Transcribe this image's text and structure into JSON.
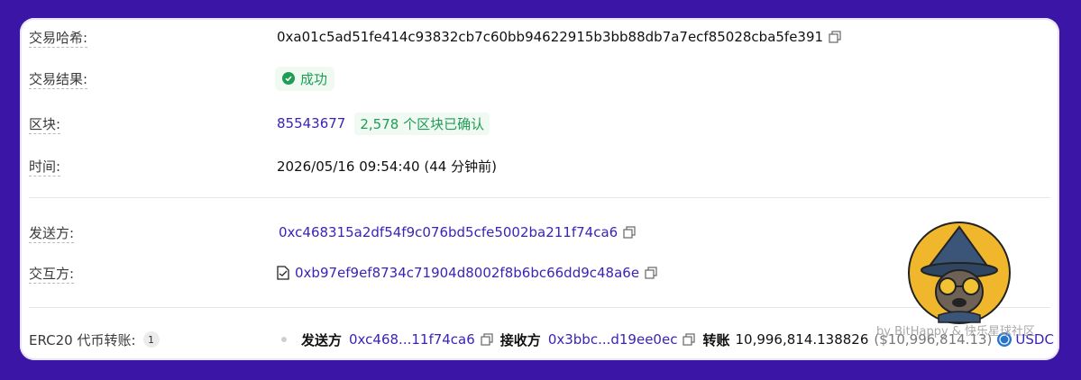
{
  "transaction": {
    "hash_label": "交易哈希:",
    "hash_value": "0xa01c5ad51fe414c93832cb7c60bb94622915b3bb88db7a7ecf85028cba5fe391",
    "result_label": "交易结果:",
    "result_value": "成功",
    "block_label": "区块:",
    "block_number": "85543677",
    "block_confirm": "2,578 个区块已确认",
    "time_label": "时间:",
    "time_value": "2026/05/16 09:54:40 (44 分钟前)"
  },
  "parties": {
    "from_label": "发送方:",
    "from_value": "0xc468315a2df54f9c076bd5cfe5002ba211f74ca6",
    "to_label": "交互方:",
    "to_value": "0xb97ef9ef8734c71904d8002f8b6bc66dd9c48a6e"
  },
  "erc20": {
    "label": "ERC20 代币转账:",
    "count": "1",
    "from_label": "发送方",
    "from_short": "0xc468...11f74ca6",
    "to_label": "接收方",
    "to_short": "0x3bbc...d19ee0ec",
    "transfer_label": "转账",
    "amount": "10,996,814.138826",
    "usd_value": "($10,996,814.13)",
    "token": "USDC"
  },
  "watermark": "by BitHappy & 快乐星球社区",
  "colors": {
    "accent": "#3d22b8",
    "success": "#1f9d55",
    "background": "#3b16a6"
  }
}
